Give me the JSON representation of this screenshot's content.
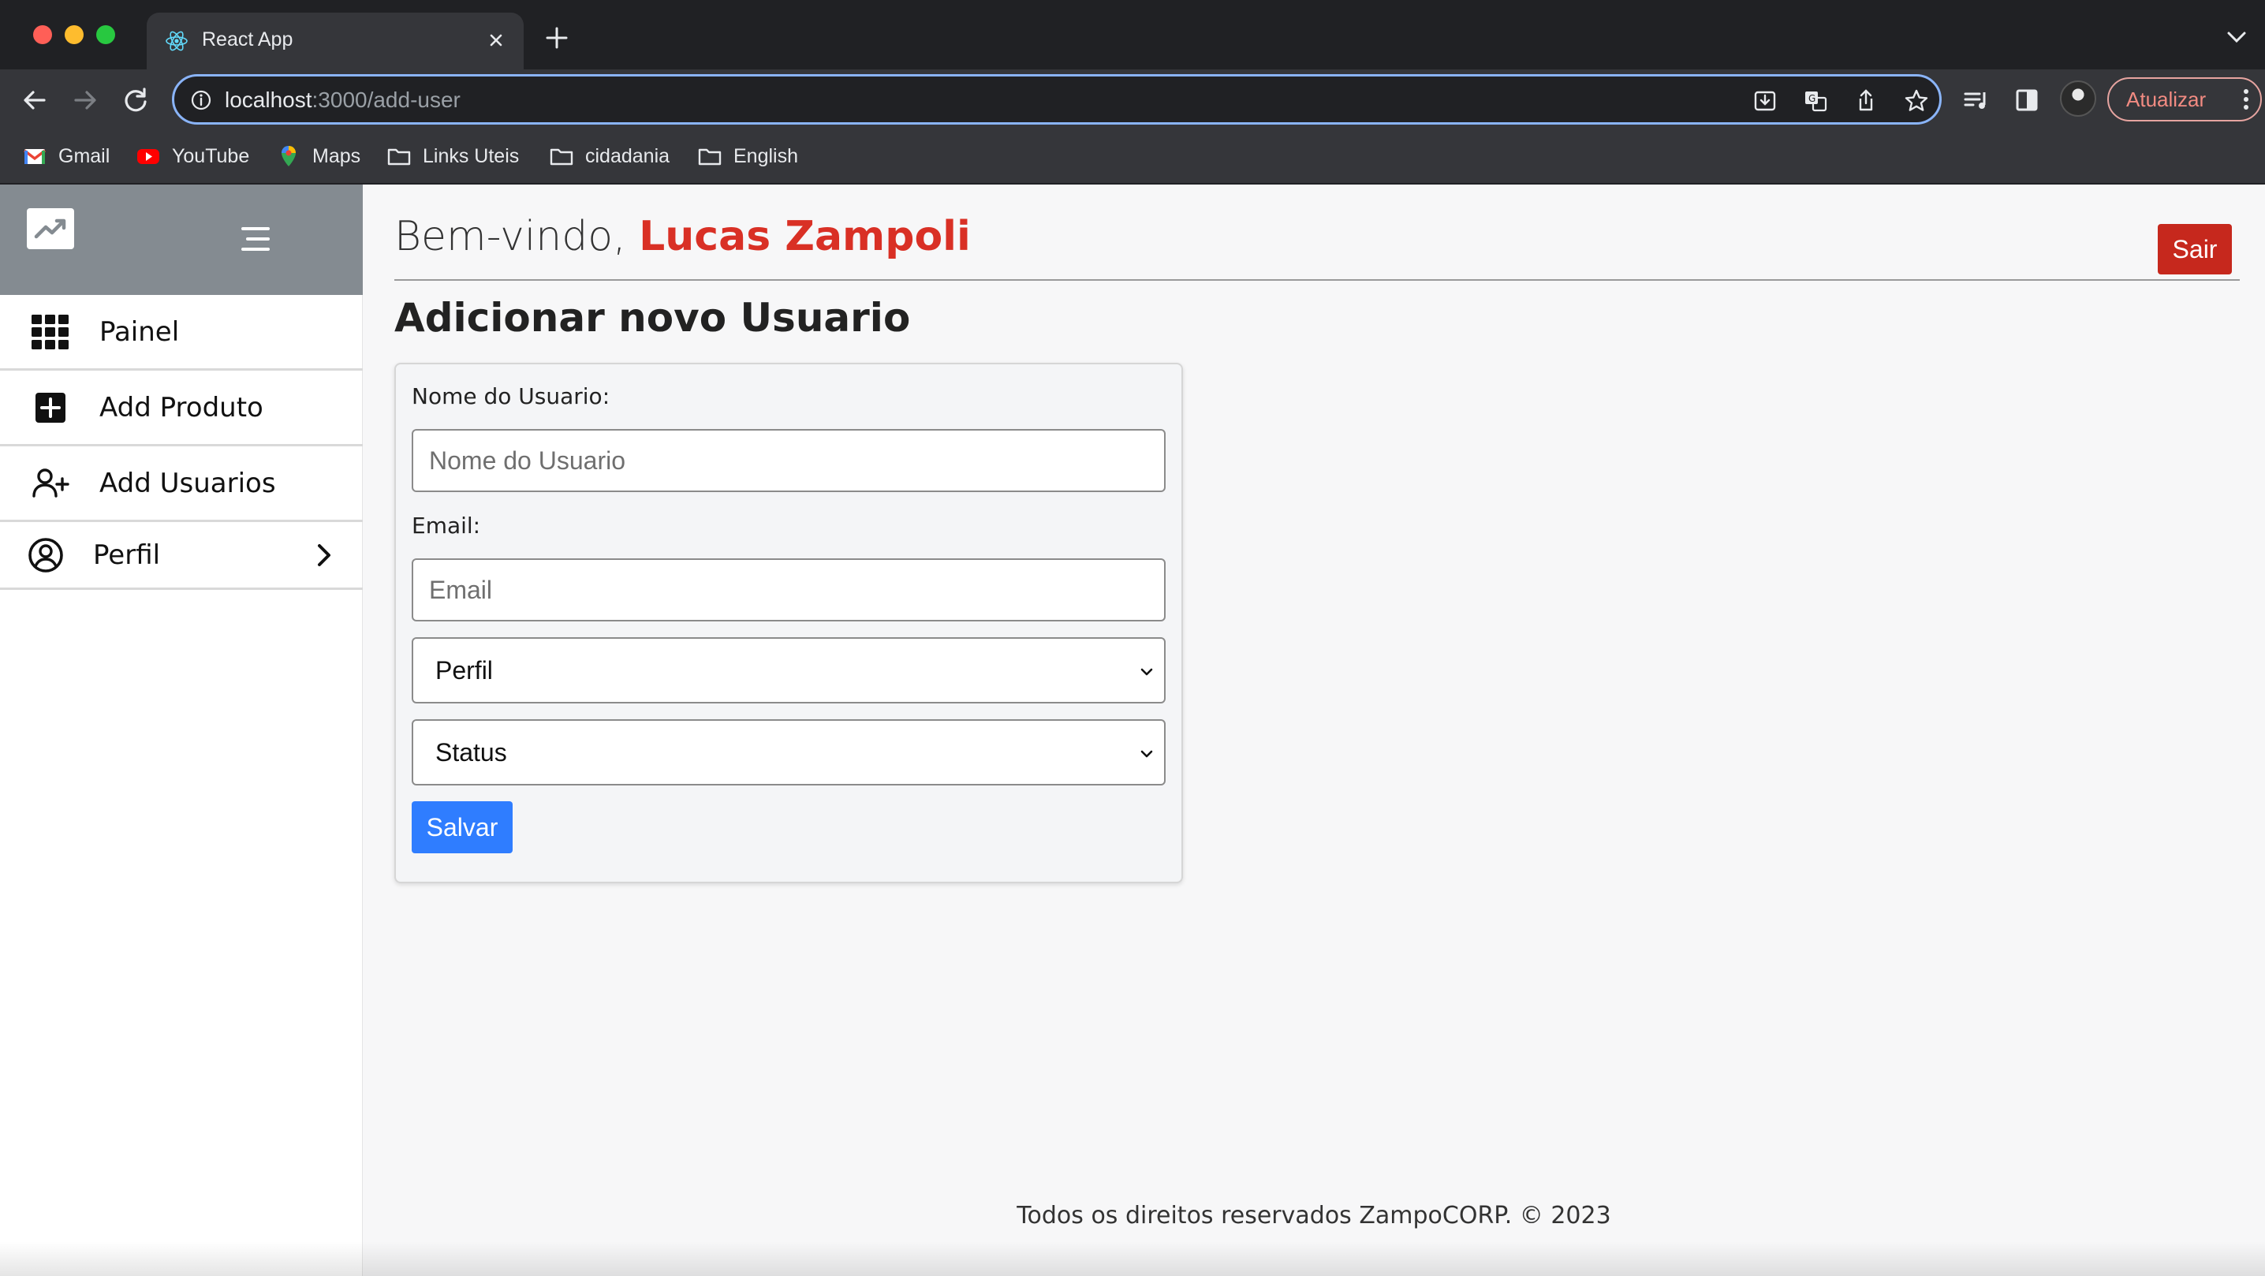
{
  "browser": {
    "tab_title": "React App",
    "url_host": "localhost",
    "url_path": ":3000/add-user",
    "update_label": "Atualizar",
    "bookmarks": [
      {
        "label": "Gmail",
        "icon": "gmail-icon"
      },
      {
        "label": "YouTube",
        "icon": "youtube-icon"
      },
      {
        "label": "Maps",
        "icon": "maps-icon"
      },
      {
        "label": "Links Uteis",
        "icon": "folder-icon"
      },
      {
        "label": "cidadania",
        "icon": "folder-icon"
      },
      {
        "label": "English",
        "icon": "folder-icon"
      }
    ],
    "colors": {
      "omnibox_focus": "#8ab4f8",
      "update_accent": "#f28b82"
    }
  },
  "sidebar": {
    "items": [
      {
        "label": "Painel",
        "icon": "grid-icon"
      },
      {
        "label": "Add Produto",
        "icon": "plus-square-icon"
      },
      {
        "label": "Add Usuarios",
        "icon": "user-plus-icon"
      },
      {
        "label": "Perfil",
        "icon": "user-circle-icon"
      }
    ],
    "header_color": "#848b91"
  },
  "header": {
    "greeting": "Bem-vindo,",
    "user_name": "Lucas Zampoli",
    "logout_label": "Sair",
    "accent_color": "#d93025"
  },
  "page": {
    "title": "Adicionar novo Usuario"
  },
  "form": {
    "name_label": "Nome do Usuario:",
    "name_placeholder": "Nome do Usuario",
    "email_label": "Email:",
    "email_placeholder": "Email",
    "profile_select": "Perfil",
    "status_select": "Status",
    "save_label": "Salvar",
    "save_color": "#2f7dff"
  },
  "footer": {
    "text": "Todos os direitos reservados ZampoCORP. © 2023"
  }
}
